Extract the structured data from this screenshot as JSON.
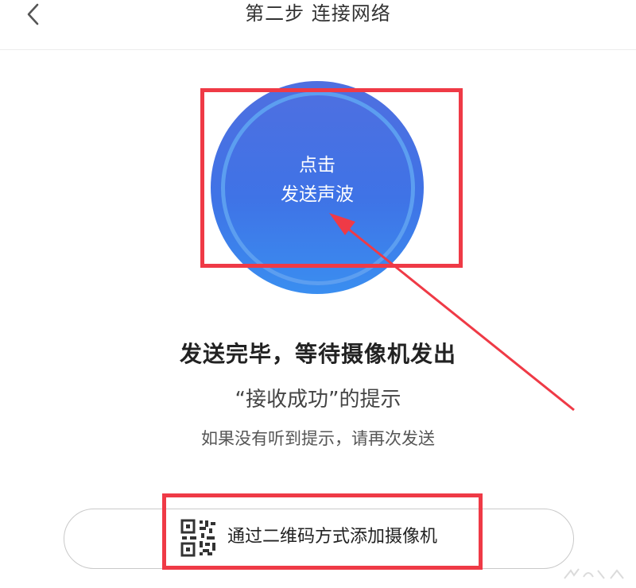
{
  "header": {
    "title": "第二步 连接网络",
    "back_icon": "chevron-left-icon"
  },
  "sound_button": {
    "line1": "点击",
    "line2": "发送声波",
    "color_top": "#4f6fe0",
    "color_bottom": "#3a8ef0",
    "ring_color": "#5c9ef0"
  },
  "messages": {
    "main": "发送完毕，等待摄像机发出",
    "sub": "“接收成功”的提示",
    "hint": "如果没有听到提示，请再次发送"
  },
  "qr_button": {
    "label": "通过二维码方式添加摄像机",
    "icon": "qr-code-icon"
  },
  "annotation": {
    "color": "#ef3a46"
  }
}
